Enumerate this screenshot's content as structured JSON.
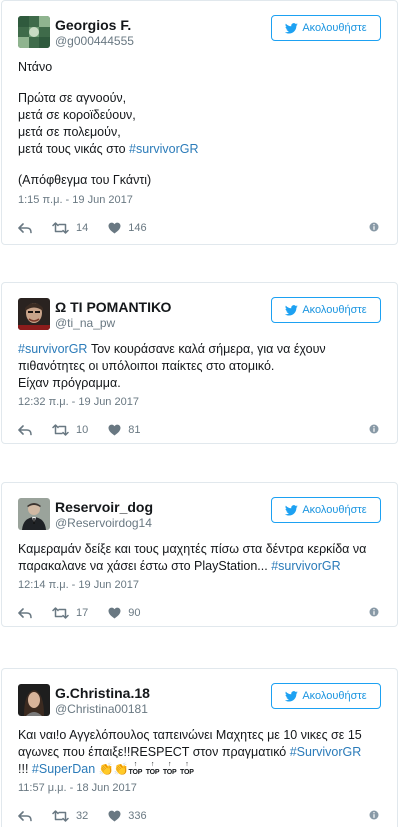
{
  "follow_label": "Ακολουθήστε",
  "colors": {
    "accent": "#1da1f2",
    "hashtag": "#2b7bb9",
    "muted": "#697882",
    "border": "#e1e8ed"
  },
  "tweets": [
    {
      "author": {
        "name": "Georgios F.",
        "handle": "@g000444555",
        "avatar_icon": "green-pattern-avatar"
      },
      "lines": [
        "Ντάνο",
        "Πρώτα σε αγνοούν,",
        "μετά σε κοροϊδεύουν,",
        "μετά σε πολεμούν,",
        "μετά τους νικάς στο",
        "#survivorGR",
        "(Απόφθεγμα του Γκάντι)"
      ],
      "timestamp": "1:15 π.μ. - 19 Jun 2017",
      "retweets": "14",
      "likes": "146"
    },
    {
      "author": {
        "name": "Ω ΤΙ ΡΟΜΑΝΤΙΚΟ",
        "handle": "@ti_na_pw",
        "avatar_icon": "movie-character-avatar"
      },
      "lines": [
        "#survivorGR",
        "Τον κουράσανε καλά σήμερα, για να έχουν",
        "πιθανότητες οι υπόλοιποι παίκτες στο ατομικό.",
        "Είχαν πρόγραμμα."
      ],
      "timestamp": "12:32 π.μ. - 19 Jun 2017",
      "retweets": "10",
      "likes": "81"
    },
    {
      "author": {
        "name": "Reservoir_dog",
        "handle": "@Reservoirdog14",
        "avatar_icon": "suited-man-avatar"
      },
      "lines": [
        "Καμεραμάν δείξε και τους μαχητές πίσω στα δέντρα κερκίδα να",
        "παρακαλανε να χάσει έστω στο PlayStation...",
        "#survivorGR"
      ],
      "timestamp": "12:14 π.μ. - 19 Jun 2017",
      "retweets": "17",
      "likes": "90"
    },
    {
      "author": {
        "name": "G.Christina.18",
        "handle": "@Christina00181",
        "avatar_icon": "portrait-avatar"
      },
      "lines": [
        "Και ναι!ο Αγγελόπουλος ταπεινώνει Μαχητες με 10 νικες σε 15",
        "αγωνες που έπαιξε!!RESPECT στον πραγματικό",
        "#SurvivorGR",
        "!!!",
        "#SuperDan",
        "TOP"
      ],
      "emojis": [
        "clapping-hands",
        "clapping-hands"
      ],
      "timestamp": "11:57 μ.μ. - 18 Jun 2017",
      "retweets": "32",
      "likes": "336"
    }
  ]
}
